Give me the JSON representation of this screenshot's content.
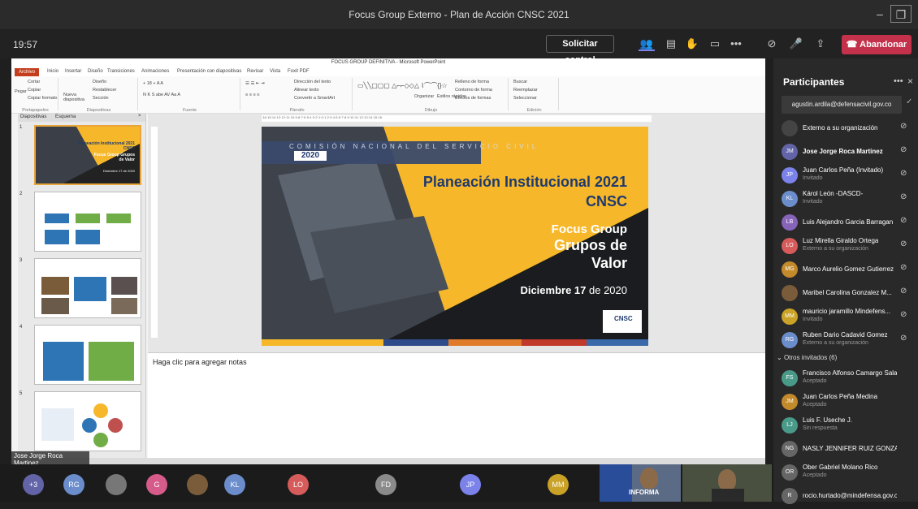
{
  "window": {
    "title": "Focus Group Externo - Plan de Acción CNSC 2021"
  },
  "toolbar": {
    "time": "19:57",
    "request_control": "Solicitar control",
    "leave": "Abandonar"
  },
  "ppt": {
    "title": "FOCUS GROUP DEFINITIVA - Microsoft PowerPoint",
    "menu": [
      "Archivo",
      "Inicio",
      "Insertar",
      "Diseño",
      "Transiciones",
      "Animaciones",
      "Presentación con diapositivas",
      "Revisar",
      "Vista",
      "Foxit PDF"
    ],
    "groups": [
      "Portapapeles",
      "Diapositivas",
      "Fuente",
      "Párrafo",
      "Dibujo",
      "Edición"
    ],
    "ribbon_items": [
      "Cortar",
      "Copiar",
      "Copiar formato",
      "Pegar",
      "Nueva diapositiva",
      "Diseño",
      "Restablecer",
      "Sección",
      "Dirección del texto",
      "Alinear texto",
      "Convertir a SmartArt",
      "Organizar",
      "Estilos rápidos",
      "Relleno de forma",
      "Contorno de forma",
      "Efectos de formas",
      "Buscar",
      "Reemplazar",
      "Seleccionar"
    ],
    "panel_tabs": [
      "Diapositivas",
      "Esquema"
    ],
    "slide_numbers": [
      "1",
      "2",
      "3",
      "4",
      "5"
    ],
    "notes": "Haga clic para agregar notas",
    "thumb1": {
      "title": "Planeación Institucional 2021 CNSC",
      "sub": "Focus Group Grupos de Valor",
      "date": "Diciembre 17 de 2020"
    }
  },
  "slide": {
    "banner": "COMISIÓN NACIONAL DEL SERVICIO CIVIL",
    "year": "2020",
    "title1": "Planeación Institucional 2021",
    "title2": "CNSC",
    "sub1": "Focus Group",
    "sub2": "Grupos de",
    "sub3": "Valor",
    "date_a": "Diciembre 17",
    "date_b": "de 2020",
    "logo": "CNSC"
  },
  "participants": {
    "title": "Participantes",
    "search": "agustin.ardila@defensacivil.gov.co",
    "people": [
      {
        "initials": "",
        "name": "Externo a su organización",
        "sub": "",
        "color": "#444"
      },
      {
        "initials": "JM",
        "name": "Jose Jorge Roca Martinez",
        "sub": "",
        "color": "#6264a7",
        "bold": true
      },
      {
        "initials": "JP",
        "name": "Juan Carlos Peña (Invitado)",
        "sub": "Invitado",
        "color": "#7b83eb"
      },
      {
        "initials": "KL",
        "name": "Károl León -DASCD-",
        "sub": "Invitado",
        "color": "#6b8dcc"
      },
      {
        "initials": "LB",
        "name": "Luis Alejandro Garcia Barragan",
        "sub": "",
        "color": "#8764b8"
      },
      {
        "initials": "LO",
        "name": "Luz Mirella Giraldo Ortega",
        "sub": "Externo a su organización",
        "color": "#d65b5b"
      },
      {
        "initials": "MG",
        "name": "Marco Aurelio Gomez Gutierrez",
        "sub": "",
        "color": "#c38a2b"
      },
      {
        "initials": "",
        "name": "Maribel Carolina Gonzalez M...",
        "sub": "",
        "color": "#7a5c3a"
      },
      {
        "initials": "MM",
        "name": "mauricio jaramillo Mindefens...",
        "sub": "Invitado",
        "color": "#c9a227"
      },
      {
        "initials": "RG",
        "name": "Ruben Dario Cadavid Gomez",
        "sub": "Externo a su organización",
        "color": "#6b8dcc"
      }
    ],
    "others_label": "Otros invitados (6)",
    "others": [
      {
        "initials": "FS",
        "name": "Francisco Alfonso Camargo Salas",
        "sub": "Aceptado",
        "color": "#4a9a8a"
      },
      {
        "initials": "JM",
        "name": "Juan Carlos Peña Medina",
        "sub": "Aceptado",
        "color": "#c38a2b"
      },
      {
        "initials": "LJ",
        "name": "Luis F. Useche J.",
        "sub": "Sin respuesta",
        "color": "#4a9a8a"
      },
      {
        "initials": "NG",
        "name": "NASLY JENNIFER RUIZ GONZALEZ",
        "sub": "",
        "color": "#666"
      },
      {
        "initials": "OR",
        "name": "Ober Gabriel Molano Rico",
        "sub": "Aceptado",
        "color": "#666"
      },
      {
        "initials": "R",
        "name": "rocio.hurtado@mindefensa.gov.co",
        "sub": "",
        "color": "#666"
      }
    ]
  },
  "bottom": {
    "presenter": "Jose Jorge Roca Martinez",
    "avatars": [
      "+3",
      "RG",
      "",
      "G",
      "",
      "KL",
      "LO",
      "FD",
      "JP",
      "MM"
    ],
    "colors": [
      "#6264a7",
      "#6b8dcc",
      "#777",
      "#d65b8a",
      "#7a5c3a",
      "#6b8dcc",
      "#d65b5b",
      "#8a8a8a",
      "#7b83eb",
      "#c9a227"
    ],
    "video_label": "INFORMA"
  }
}
